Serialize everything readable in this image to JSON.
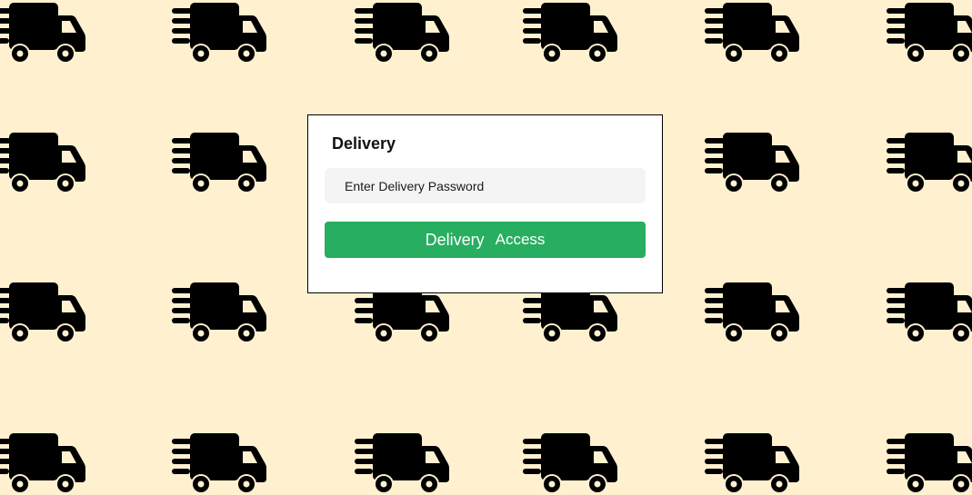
{
  "background": {
    "color": "#fff1cf",
    "pattern_icon": "delivery-truck-icon",
    "icon_color": "#000000"
  },
  "login_card": {
    "title": "Delivery",
    "password_field": {
      "placeholder": "Enter Delivery Password",
      "value": ""
    },
    "access_button": {
      "label_word1": "Delivery",
      "label_word2": "Access",
      "color": "#27ae60"
    }
  }
}
